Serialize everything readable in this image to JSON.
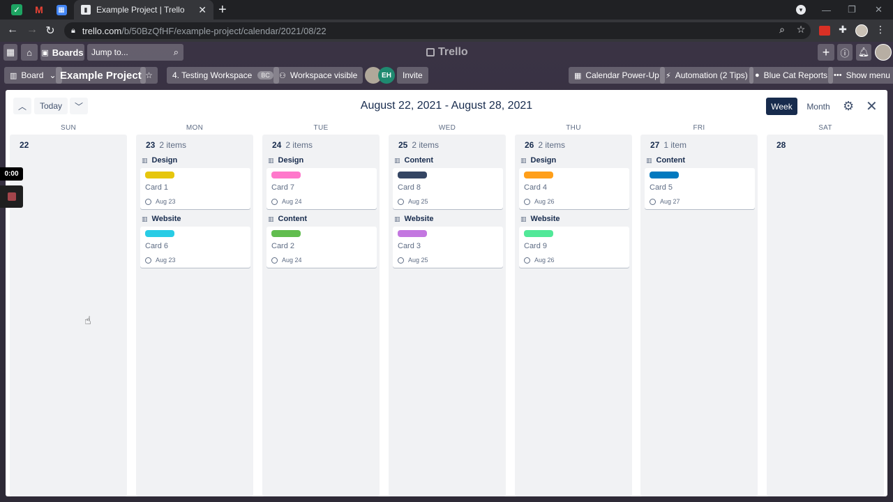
{
  "browser": {
    "tab_title": "Example Project | Trello",
    "url_host": "trello.com",
    "url_path": "/b/50BzQfHF/example-project/calendar/2021/08/22"
  },
  "header": {
    "boards_label": "Boards",
    "jump_placeholder": "Jump to...",
    "logo_text": "Trello"
  },
  "board": {
    "view_label": "Board",
    "title": "Example Project",
    "workspace": "4. Testing Workspace",
    "workspace_badge": "BC",
    "visibility": "Workspace visible",
    "member_initials": "EH",
    "invite_label": "Invite",
    "calendar_powerup": "Calendar Power-Up",
    "automation": "Automation (2 Tips)",
    "bluecat": "Blue Cat Reports",
    "show_menu": "Show menu"
  },
  "calendar": {
    "today_label": "Today",
    "range": "August 22, 2021 - August 28, 2021",
    "week_label": "Week",
    "month_label": "Month",
    "days": [
      {
        "dow": "SUN",
        "num": "22",
        "count": "",
        "groups": []
      },
      {
        "dow": "MON",
        "num": "23",
        "count": "2 items",
        "groups": [
          {
            "list": "Design",
            "card": "Card 1",
            "due": "Aug 23",
            "color": "#e6c60d"
          },
          {
            "list": "Website",
            "card": "Card 6",
            "due": "Aug 23",
            "color": "#29cce5"
          }
        ]
      },
      {
        "dow": "TUE",
        "num": "24",
        "count": "2 items",
        "groups": [
          {
            "list": "Design",
            "card": "Card 7",
            "due": "Aug 24",
            "color": "#ff78cb"
          },
          {
            "list": "Content",
            "card": "Card 2",
            "due": "Aug 24",
            "color": "#61bd4f"
          }
        ]
      },
      {
        "dow": "WED",
        "num": "25",
        "count": "2 items",
        "groups": [
          {
            "list": "Content",
            "card": "Card 8",
            "due": "Aug 25",
            "color": "#344563"
          },
          {
            "list": "Website",
            "card": "Card 3",
            "due": "Aug 25",
            "color": "#c377e0"
          }
        ]
      },
      {
        "dow": "THU",
        "num": "26",
        "count": "2 items",
        "groups": [
          {
            "list": "Design",
            "card": "Card 4",
            "due": "Aug 26",
            "color": "#ff9f1a"
          },
          {
            "list": "Website",
            "card": "Card 9",
            "due": "Aug 26",
            "color": "#51e898"
          }
        ]
      },
      {
        "dow": "FRI",
        "num": "27",
        "count": "1 item",
        "groups": [
          {
            "list": "Content",
            "card": "Card 5",
            "due": "Aug 27",
            "color": "#0079bf"
          }
        ]
      },
      {
        "dow": "SAT",
        "num": "28",
        "count": "",
        "groups": []
      }
    ]
  },
  "recorder": {
    "time": "0:00"
  }
}
